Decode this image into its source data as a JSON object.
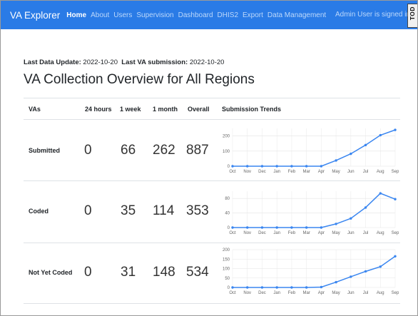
{
  "navbar": {
    "brand": "VA Explorer",
    "links": [
      "Home",
      "About",
      "Users",
      "Supervision",
      "Dashboard",
      "DHIS2",
      "Export",
      "Data Management"
    ],
    "signed_in": "Admin User is signed in.",
    "corner_badge": "TOD"
  },
  "meta": {
    "last_update_label": "Last Data Update:",
    "last_update_value": "2022-10-20",
    "last_submission_label": "Last VA submission:",
    "last_submission_value": "2022-10-20"
  },
  "page_title": "VA Collection Overview for All Regions",
  "table": {
    "headers": [
      "VAs",
      "24 hours",
      "1 week",
      "1 month",
      "Overall",
      "Submission Trends"
    ],
    "rows": [
      {
        "label": "Submitted",
        "h24": "0",
        "week": "66",
        "month": "262",
        "overall": "887"
      },
      {
        "label": "Coded",
        "h24": "0",
        "week": "35",
        "month": "114",
        "overall": "353"
      },
      {
        "label": "Not Yet Coded",
        "h24": "0",
        "week": "31",
        "month": "148",
        "overall": "534"
      }
    ]
  },
  "chart_data": [
    {
      "type": "line",
      "x": [
        "Oct",
        "Nov",
        "Dec",
        "Jan",
        "Feb",
        "Mar",
        "Apr",
        "May",
        "Jun",
        "Jul",
        "Aug",
        "Sep"
      ],
      "series": [
        {
          "values": [
            0,
            0,
            0,
            0,
            0,
            0,
            0,
            38,
            82,
            140,
            205,
            240
          ]
        }
      ],
      "yticks": [
        0,
        100,
        200
      ],
      "ylim": [
        0,
        250
      ],
      "grid": true,
      "color": "#3a86f0"
    },
    {
      "type": "line",
      "x": [
        "Oct",
        "Nov",
        "Dec",
        "Jan",
        "Feb",
        "Mar",
        "Apr",
        "May",
        "Jun",
        "Jul",
        "Aug",
        "Sep"
      ],
      "series": [
        {
          "values": [
            0,
            0,
            0,
            0,
            0,
            0,
            0,
            10,
            25,
            55,
            94,
            78
          ]
        }
      ],
      "yticks": [
        0,
        40,
        80
      ],
      "ylim": [
        0,
        100
      ],
      "grid": true,
      "color": "#3a86f0"
    },
    {
      "type": "line",
      "x": [
        "Oct",
        "Nov",
        "Dec",
        "Jan",
        "Feb",
        "Mar",
        "Apr",
        "May",
        "Jun",
        "Jul",
        "Aug",
        "Sep"
      ],
      "series": [
        {
          "values": [
            0,
            0,
            0,
            0,
            0,
            0,
            2,
            28,
            57,
            85,
            110,
            165
          ]
        }
      ],
      "yticks": [
        0,
        50,
        100,
        150,
        200
      ],
      "ylim": [
        0,
        200
      ],
      "grid": true,
      "color": "#3a86f0"
    }
  ]
}
